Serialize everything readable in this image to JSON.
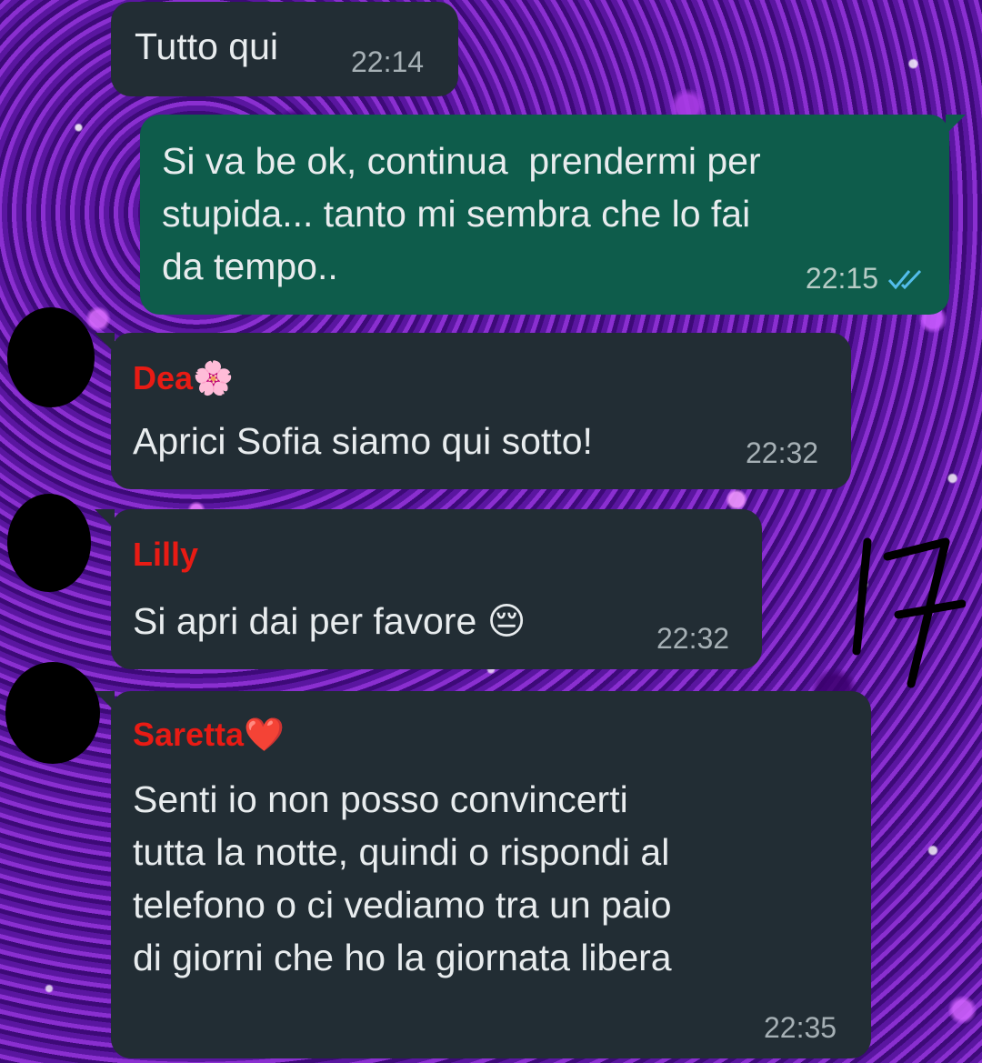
{
  "messages": [
    {
      "direction": "in",
      "sender": "",
      "text": "Tutto qui",
      "time": "22:14"
    },
    {
      "direction": "out",
      "text": "Si va be ok, continua  prendermi per\nstupida... tanto mi sembra che lo fai\nda tempo..",
      "time": "22:15",
      "status_icon": "double-check-read-icon"
    },
    {
      "direction": "in",
      "sender": "Dea",
      "sender_emoji": "🌸",
      "text": "Aprici Sofia siamo qui sotto!",
      "time": "22:32"
    },
    {
      "direction": "in",
      "sender": "Lilly",
      "text": "Si apri dai per favore 😔",
      "time": "22:32"
    },
    {
      "direction": "in",
      "sender": "Saretta",
      "sender_emoji": "❤️",
      "text": "Senti io non posso convincerti\ntutta la notte, quindi o rispondi al\ntelefono o ci vediamo tra un paio\ndi giorni che ho la giornata libera",
      "time": "22:35"
    }
  ],
  "handwritten_annotation": "17",
  "colors": {
    "incoming_bubble": "#222d34",
    "outgoing_bubble": "#0e5c4b",
    "sender_name": "#e81b14",
    "read_ticks": "#53bdeb"
  }
}
